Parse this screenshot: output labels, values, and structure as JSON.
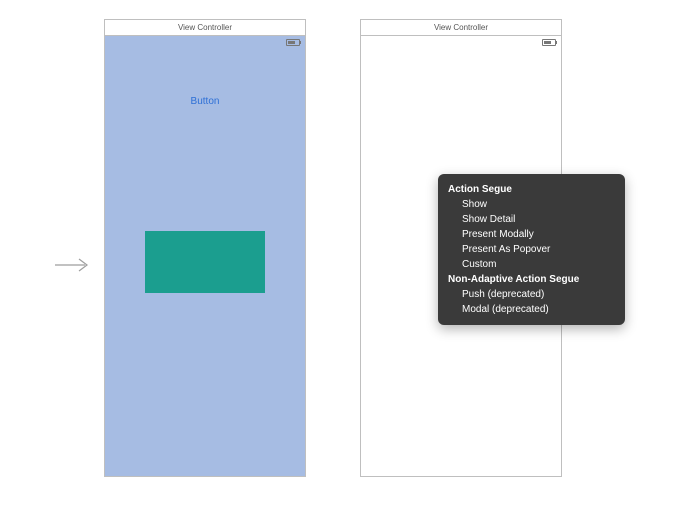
{
  "left_vc": {
    "title": "View Controller",
    "button_label": "Button"
  },
  "right_vc": {
    "title": "View Controller"
  },
  "popover": {
    "section1_title": "Action Segue",
    "section1_items": [
      "Show",
      "Show Detail",
      "Present Modally",
      "Present As Popover",
      "Custom"
    ],
    "section2_title": "Non-Adaptive Action Segue",
    "section2_items": [
      "Push (deprecated)",
      "Modal (deprecated)"
    ]
  }
}
